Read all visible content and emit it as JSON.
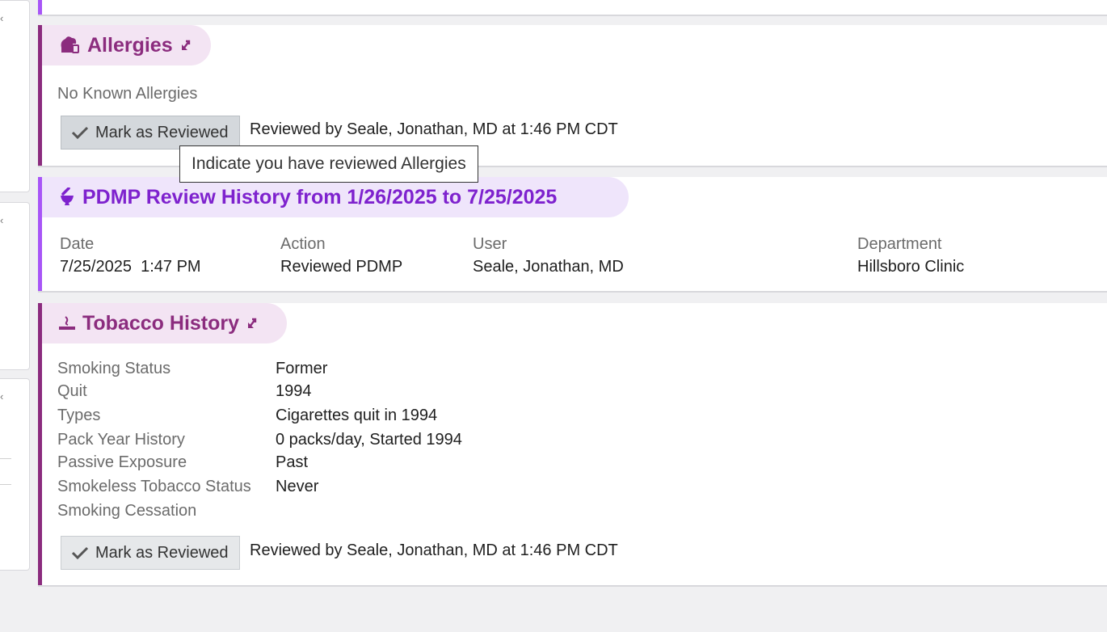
{
  "allergies": {
    "title": "Allergies",
    "status": "No Known Allergies",
    "review_button": "Mark as Reviewed",
    "reviewed_text": "Reviewed by Seale, Jonathan, MD at 1:46 PM CDT",
    "tooltip": "Indicate you have reviewed Allergies"
  },
  "pdmp": {
    "title": "PDMP Review History from 1/26/2025 to 7/25/2025",
    "columns": [
      "Date",
      "Action",
      "User",
      "Department"
    ],
    "rows": [
      [
        "7/25/2025  1:47 PM",
        "Reviewed PDMP",
        "Seale, Jonathan, MD",
        "Hillsboro Clinic"
      ]
    ]
  },
  "tobacco": {
    "title": "Tobacco History",
    "fields": [
      {
        "label": "Smoking Status",
        "value": "Former"
      },
      {
        "label": "Quit",
        "value": "1994"
      },
      {
        "label": "Types",
        "value": "Cigarettes quit in 1994"
      },
      {
        "label": "Pack Year History",
        "value": "0 packs/day, Started 1994"
      },
      {
        "label": "Passive Exposure",
        "value": "Past"
      },
      {
        "label": "Smokeless Tobacco Status",
        "value": "Never"
      },
      {
        "label": "Smoking Cessation",
        "value": ""
      }
    ],
    "review_button": "Mark as Reviewed",
    "reviewed_text": "Reviewed by Seale, Jonathan, MD at 1:46 PM CDT"
  },
  "colors": {
    "accent_plum": "#8b2c7e",
    "accent_purple": "#7e22ce",
    "bar_purple": "#a855f7"
  }
}
